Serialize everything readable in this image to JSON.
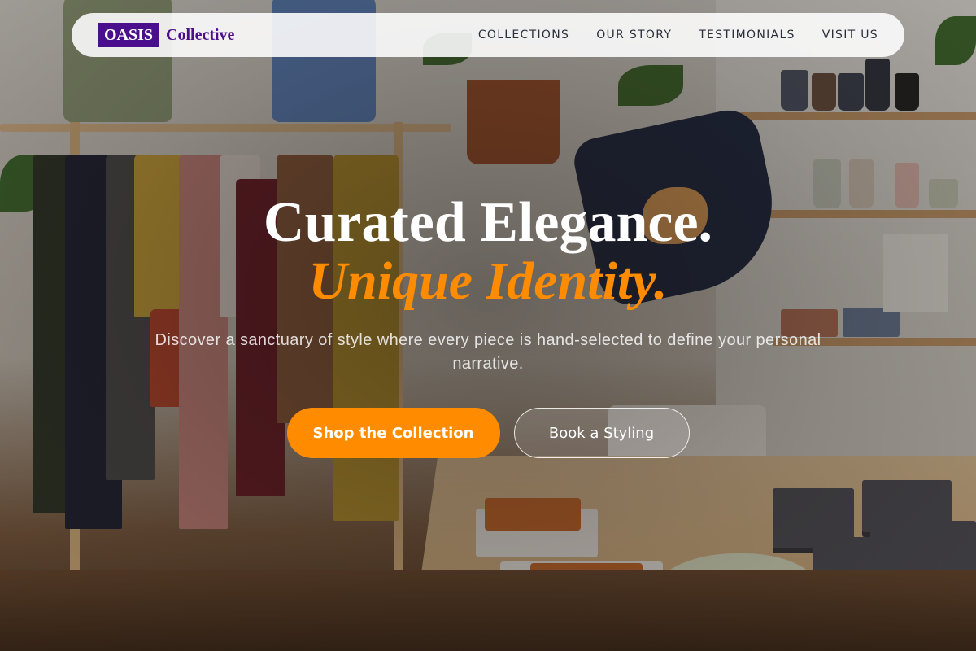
{
  "brand": {
    "box": "OASIS",
    "name": "Collective"
  },
  "nav": {
    "links": [
      "COLLECTIONS",
      "OUR STORY",
      "TESTIMONIALS",
      "VISIT US"
    ]
  },
  "hero": {
    "headline": "Curated Elegance.",
    "headline_accent": "Unique Identity.",
    "subtext": "Discover a sanctuary of style where every piece is hand-selected to define your personal narrative.",
    "cta_primary": "Shop the Collection",
    "cta_secondary": "Book a Styling"
  },
  "colors": {
    "brand_purple": "#4a0f8c",
    "accent_orange": "#ff8c00",
    "nav_text": "#2b2f3a"
  }
}
